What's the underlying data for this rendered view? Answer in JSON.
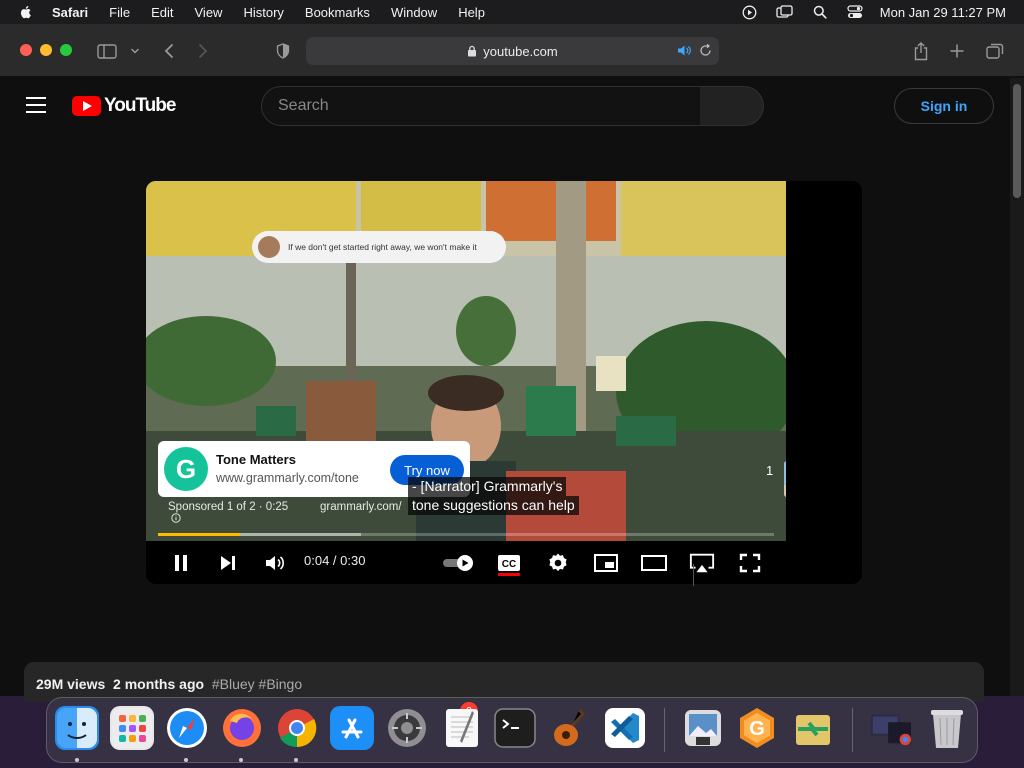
{
  "menubar": {
    "app_name": "Safari",
    "items": [
      "File",
      "Edit",
      "View",
      "History",
      "Bookmarks",
      "Window",
      "Help"
    ],
    "clock": "Mon Jan 29  11:27 PM"
  },
  "browser": {
    "address": "youtube.com"
  },
  "youtube": {
    "logo_text": "YouTube",
    "search_placeholder": "Search",
    "signin_label": "Sign in"
  },
  "player": {
    "overlay_bubble_text": "If we don't get started right away, we won't make it",
    "ad": {
      "title": "Tone Matters",
      "url": "www.grammarly.com/tone",
      "cta": "Try now",
      "logo_letter": "G"
    },
    "caption_lines": [
      "- [Narrator] Grammarly's",
      "tone suggestions can help"
    ],
    "sponsored_label": "Sponsored 1 of 2 · 0:25",
    "sponsored_url": "grammarly.com/",
    "queue_count": "1",
    "time_display": "0:04 / 0:30",
    "progress_fraction": 0.133,
    "buffer_fraction": 0.33,
    "cc_label": "CC"
  },
  "below": {
    "views": "29M views",
    "age": "2 months ago",
    "tags": "#Bluey #Bingo"
  },
  "dock": {
    "settings_badge": "2",
    "icons": [
      "finder-icon",
      "launchpad-icon",
      "safari-icon",
      "firefox-icon",
      "chrome-icon",
      "app-store-icon",
      "system-settings-icon",
      "textedit-icon",
      "terminal-icon",
      "garageband-icon",
      "vscode-icon",
      "preview-icon",
      "grammarly-icon",
      "migration-icon",
      "screenshot-folder-icon",
      "trash-icon"
    ]
  },
  "colors": {
    "youtube_red": "#ff0000",
    "signin_blue": "#3ea6ff",
    "ad_button": "#065fd4",
    "progress": "#fbbc04"
  }
}
